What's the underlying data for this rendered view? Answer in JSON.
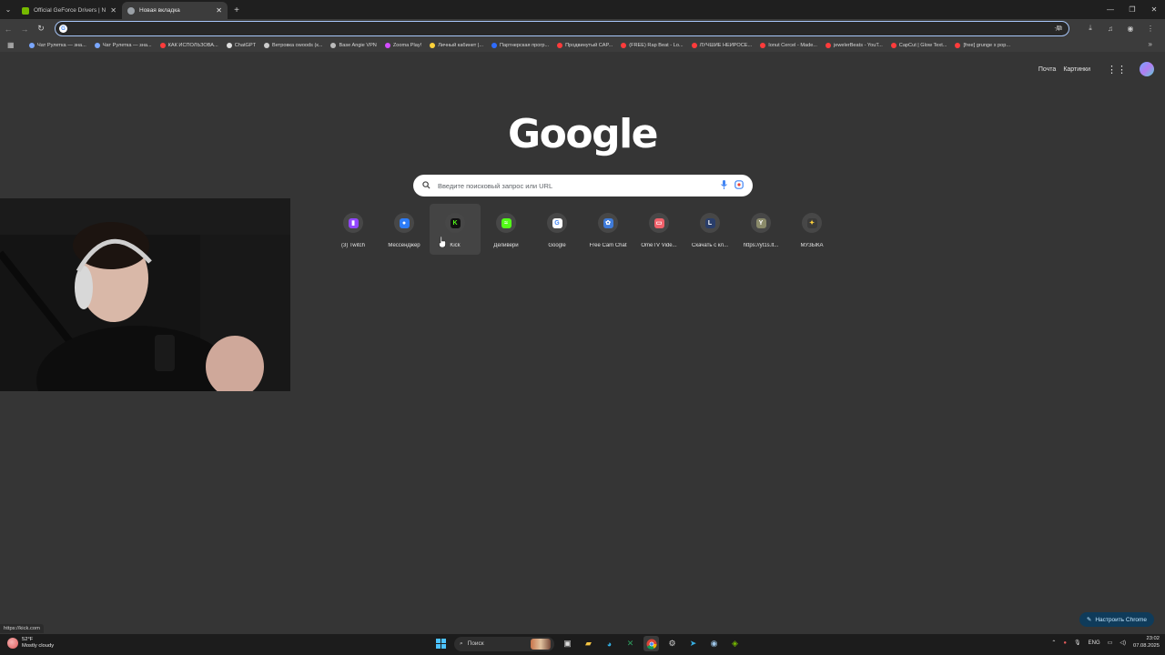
{
  "tabs": [
    {
      "title": "Official GeForce Drivers | NVIDIA",
      "active": false,
      "favicon_color": "#76b900"
    },
    {
      "title": "Новая вкладка",
      "active": true,
      "favicon_color": "#9aa0a6"
    }
  ],
  "omnibox": {
    "value": "",
    "placeholder": ""
  },
  "bookmarks": [
    {
      "label": "Чат Рулетка — зна...",
      "color": "#7aa7ff"
    },
    {
      "label": "Чат Рулетка — зна...",
      "color": "#7aa7ff"
    },
    {
      "label": "КАК ИСПОЛЬЗОВА...",
      "color": "#ff3b3b"
    },
    {
      "label": "ChatGPT",
      "color": "#e0e0e0"
    },
    {
      "label": "Ветровка owoods (к...",
      "color": "#cccccc"
    },
    {
      "label": "Base Angie VPN",
      "color": "#bbbbbb"
    },
    {
      "label": "Zooma Play!",
      "color": "#d34cff"
    },
    {
      "label": "Личный кабинет |...",
      "color": "#ffd23a"
    },
    {
      "label": "Партнерская прогр...",
      "color": "#2e6cff"
    },
    {
      "label": "Продвинутый CAP...",
      "color": "#ff3b3b"
    },
    {
      "label": "(FREE) Rap Beat - Lo...",
      "color": "#ff3b3b"
    },
    {
      "label": "ЛУЧШИЕ НЕЙРОСЕ...",
      "color": "#ff3b3b"
    },
    {
      "label": "Ionut Cercel - Made...",
      "color": "#ff3b3b"
    },
    {
      "label": "jewelerBeats - YouT...",
      "color": "#ff3b3b"
    },
    {
      "label": "CapCut | Glow Text...",
      "color": "#ff3b3b"
    },
    {
      "label": "[free] grunge x pop...",
      "color": "#ff3b3b"
    }
  ],
  "header_links": {
    "mail": "Почта",
    "images": "Картинки"
  },
  "logo_text": "Google",
  "search": {
    "placeholder": "Введите поисковый запрос или URL"
  },
  "shortcuts": [
    {
      "label": "(3) Twitch",
      "color": "#9146ff",
      "glyph": "▮",
      "hover": false
    },
    {
      "label": "Мессенджер",
      "color": "#2d7cf6",
      "glyph": "●",
      "hover": false
    },
    {
      "label": "Kick",
      "color": "#111111",
      "glyph": "K",
      "glyph_color": "#53fc18",
      "hover": true
    },
    {
      "label": "Деливери",
      "color": "#53fc18",
      "glyph": "≈",
      "hover": false
    },
    {
      "label": "Google",
      "color": "#ffffff",
      "glyph": "G",
      "glyph_color": "#4285f4",
      "hover": false
    },
    {
      "label": "Free Cam Chat",
      "color": "#3f7bd9",
      "glyph": "✿",
      "hover": false
    },
    {
      "label": "OmeTV Vide...",
      "color": "#f0606a",
      "glyph": "▭",
      "hover": false
    },
    {
      "label": "Скачать с кл...",
      "color": "#2a3e6a",
      "glyph": "L",
      "hover": false
    },
    {
      "label": "https://yt1s.lt...",
      "color": "#8a8a6a",
      "glyph": "Y",
      "hover": false
    },
    {
      "label": "МУЗЫКА",
      "color": "#3a3a3a",
      "glyph": "✦",
      "glyph_color": "#ffd23a",
      "hover": false
    }
  ],
  "customize_label": "Настроить Chrome",
  "status_url": "https://kick.com",
  "taskbar": {
    "weather_temp": "52°F",
    "weather_desc": "Mostly cloudy",
    "search_label": "Поиск",
    "language": "ENG",
    "time": "23:02",
    "date": "07.08.2025"
  }
}
